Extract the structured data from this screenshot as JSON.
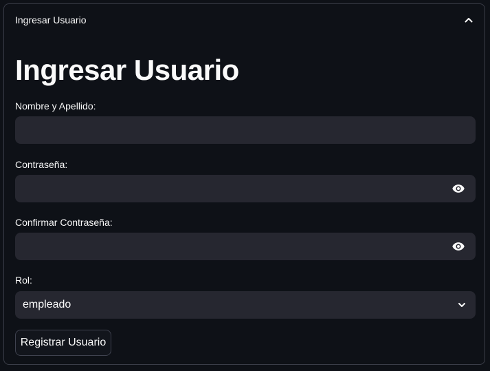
{
  "expander": {
    "title": "Ingresar Usuario",
    "icon": "chevron-up-icon"
  },
  "form": {
    "heading": "Ingresar Usuario",
    "name_label": "Nombre y Apellido:",
    "name_value": "",
    "password_label": "Contraseña:",
    "password_value": "",
    "confirm_label": "Confirmar Contraseña:",
    "confirm_value": "",
    "role_label": "Rol:",
    "role_value": "empleado",
    "submit_label": "Registrar Usuario"
  },
  "colors": {
    "background": "#0e1117",
    "input_background": "#262730",
    "border": "#3a3d48",
    "text": "#fafafa"
  }
}
